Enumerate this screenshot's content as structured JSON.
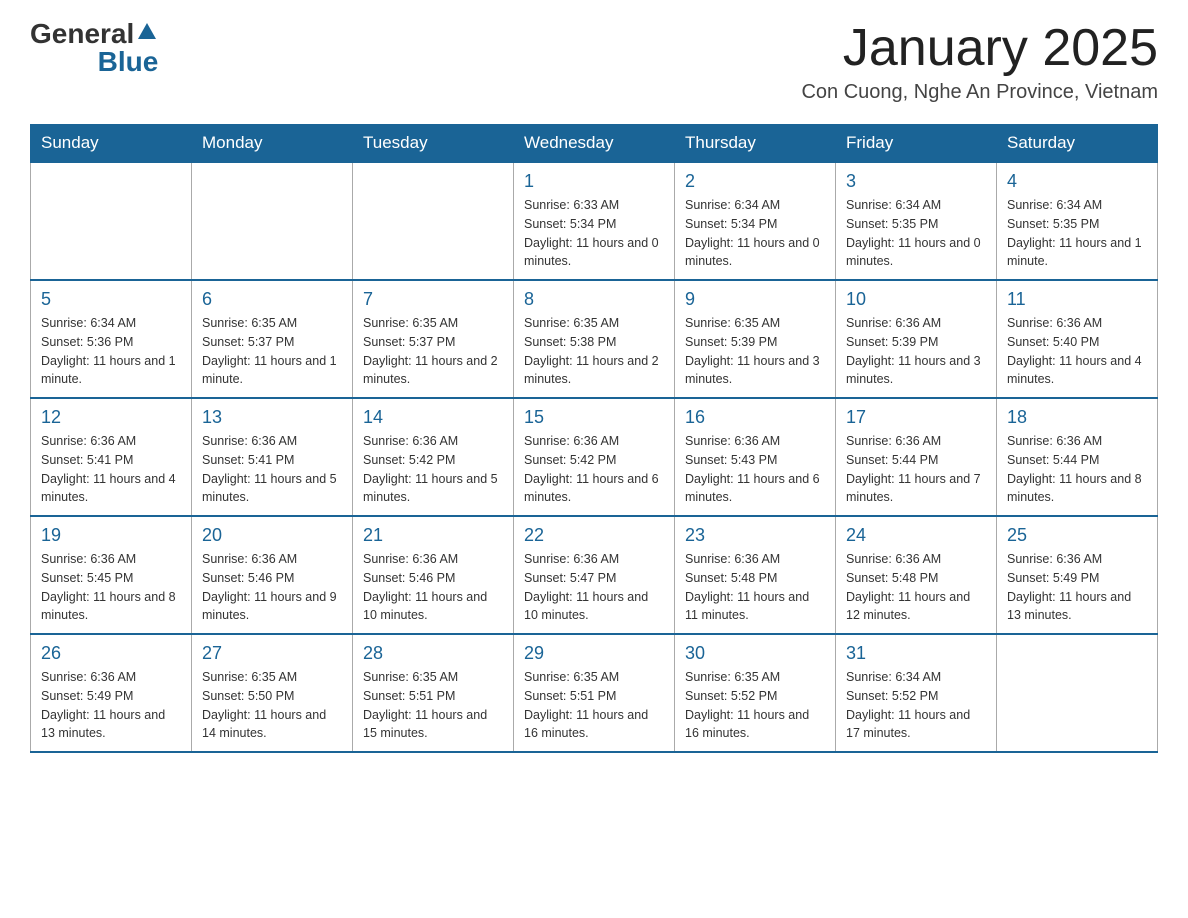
{
  "header": {
    "logo_general": "General",
    "logo_blue": "Blue",
    "month_title": "January 2025",
    "location": "Con Cuong, Nghe An Province, Vietnam"
  },
  "weekdays": [
    "Sunday",
    "Monday",
    "Tuesday",
    "Wednesday",
    "Thursday",
    "Friday",
    "Saturday"
  ],
  "weeks": [
    [
      {
        "day": "",
        "info": ""
      },
      {
        "day": "",
        "info": ""
      },
      {
        "day": "",
        "info": ""
      },
      {
        "day": "1",
        "info": "Sunrise: 6:33 AM\nSunset: 5:34 PM\nDaylight: 11 hours and 0 minutes."
      },
      {
        "day": "2",
        "info": "Sunrise: 6:34 AM\nSunset: 5:34 PM\nDaylight: 11 hours and 0 minutes."
      },
      {
        "day": "3",
        "info": "Sunrise: 6:34 AM\nSunset: 5:35 PM\nDaylight: 11 hours and 0 minutes."
      },
      {
        "day": "4",
        "info": "Sunrise: 6:34 AM\nSunset: 5:35 PM\nDaylight: 11 hours and 1 minute."
      }
    ],
    [
      {
        "day": "5",
        "info": "Sunrise: 6:34 AM\nSunset: 5:36 PM\nDaylight: 11 hours and 1 minute."
      },
      {
        "day": "6",
        "info": "Sunrise: 6:35 AM\nSunset: 5:37 PM\nDaylight: 11 hours and 1 minute."
      },
      {
        "day": "7",
        "info": "Sunrise: 6:35 AM\nSunset: 5:37 PM\nDaylight: 11 hours and 2 minutes."
      },
      {
        "day": "8",
        "info": "Sunrise: 6:35 AM\nSunset: 5:38 PM\nDaylight: 11 hours and 2 minutes."
      },
      {
        "day": "9",
        "info": "Sunrise: 6:35 AM\nSunset: 5:39 PM\nDaylight: 11 hours and 3 minutes."
      },
      {
        "day": "10",
        "info": "Sunrise: 6:36 AM\nSunset: 5:39 PM\nDaylight: 11 hours and 3 minutes."
      },
      {
        "day": "11",
        "info": "Sunrise: 6:36 AM\nSunset: 5:40 PM\nDaylight: 11 hours and 4 minutes."
      }
    ],
    [
      {
        "day": "12",
        "info": "Sunrise: 6:36 AM\nSunset: 5:41 PM\nDaylight: 11 hours and 4 minutes."
      },
      {
        "day": "13",
        "info": "Sunrise: 6:36 AM\nSunset: 5:41 PM\nDaylight: 11 hours and 5 minutes."
      },
      {
        "day": "14",
        "info": "Sunrise: 6:36 AM\nSunset: 5:42 PM\nDaylight: 11 hours and 5 minutes."
      },
      {
        "day": "15",
        "info": "Sunrise: 6:36 AM\nSunset: 5:42 PM\nDaylight: 11 hours and 6 minutes."
      },
      {
        "day": "16",
        "info": "Sunrise: 6:36 AM\nSunset: 5:43 PM\nDaylight: 11 hours and 6 minutes."
      },
      {
        "day": "17",
        "info": "Sunrise: 6:36 AM\nSunset: 5:44 PM\nDaylight: 11 hours and 7 minutes."
      },
      {
        "day": "18",
        "info": "Sunrise: 6:36 AM\nSunset: 5:44 PM\nDaylight: 11 hours and 8 minutes."
      }
    ],
    [
      {
        "day": "19",
        "info": "Sunrise: 6:36 AM\nSunset: 5:45 PM\nDaylight: 11 hours and 8 minutes."
      },
      {
        "day": "20",
        "info": "Sunrise: 6:36 AM\nSunset: 5:46 PM\nDaylight: 11 hours and 9 minutes."
      },
      {
        "day": "21",
        "info": "Sunrise: 6:36 AM\nSunset: 5:46 PM\nDaylight: 11 hours and 10 minutes."
      },
      {
        "day": "22",
        "info": "Sunrise: 6:36 AM\nSunset: 5:47 PM\nDaylight: 11 hours and 10 minutes."
      },
      {
        "day": "23",
        "info": "Sunrise: 6:36 AM\nSunset: 5:48 PM\nDaylight: 11 hours and 11 minutes."
      },
      {
        "day": "24",
        "info": "Sunrise: 6:36 AM\nSunset: 5:48 PM\nDaylight: 11 hours and 12 minutes."
      },
      {
        "day": "25",
        "info": "Sunrise: 6:36 AM\nSunset: 5:49 PM\nDaylight: 11 hours and 13 minutes."
      }
    ],
    [
      {
        "day": "26",
        "info": "Sunrise: 6:36 AM\nSunset: 5:49 PM\nDaylight: 11 hours and 13 minutes."
      },
      {
        "day": "27",
        "info": "Sunrise: 6:35 AM\nSunset: 5:50 PM\nDaylight: 11 hours and 14 minutes."
      },
      {
        "day": "28",
        "info": "Sunrise: 6:35 AM\nSunset: 5:51 PM\nDaylight: 11 hours and 15 minutes."
      },
      {
        "day": "29",
        "info": "Sunrise: 6:35 AM\nSunset: 5:51 PM\nDaylight: 11 hours and 16 minutes."
      },
      {
        "day": "30",
        "info": "Sunrise: 6:35 AM\nSunset: 5:52 PM\nDaylight: 11 hours and 16 minutes."
      },
      {
        "day": "31",
        "info": "Sunrise: 6:34 AM\nSunset: 5:52 PM\nDaylight: 11 hours and 17 minutes."
      },
      {
        "day": "",
        "info": ""
      }
    ]
  ]
}
